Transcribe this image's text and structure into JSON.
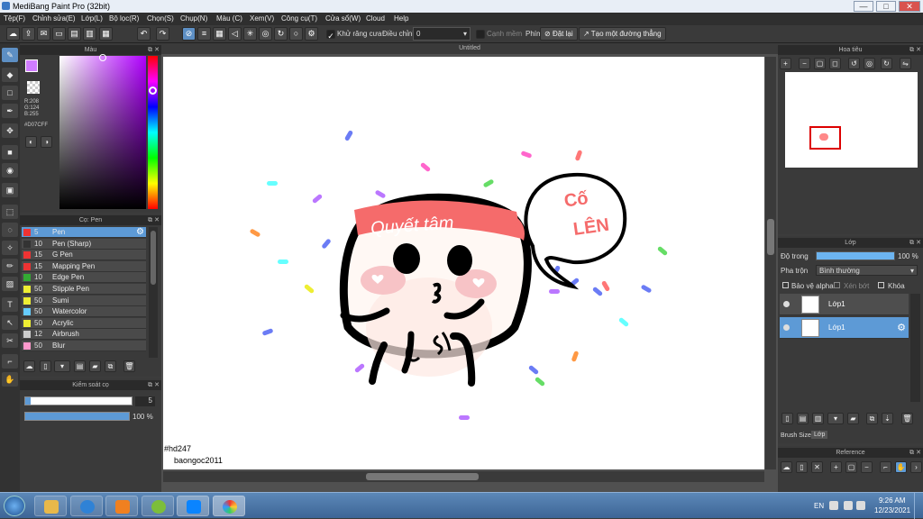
{
  "window": {
    "title": "MediBang Paint Pro (32bit)",
    "minimize": "—",
    "maximize": "□",
    "close": "✕"
  },
  "menu": [
    "Tệp(F)",
    "Chỉnh sửa(E)",
    "Lớp(L)",
    "Bộ lọc(R)",
    "Chọn(S)",
    "Chụp(N)",
    "Màu (C)",
    "Xem(V)",
    "Công cụ(T)",
    "Cửa sổ(W)",
    "Cloud",
    "Help"
  ],
  "toolbar": {
    "antialias_label": "Khử răng cưa",
    "adjust_label": "Điều chỉnh",
    "adjust_value": "0",
    "edge_label": "Cạnh mềm",
    "key_label": "Phím",
    "reset_label": "Đặt lại",
    "straight_line_label": "Tạo một đường thẳng"
  },
  "color_panel": {
    "title": "Màu",
    "r": "R:208",
    "g": "G:124",
    "b": "B:255",
    "hex": "#D07CFF",
    "fg_color": "#D07CFF"
  },
  "brush_panel": {
    "title": "Cọ: Pen",
    "items": [
      {
        "size": "5",
        "name": "Pen",
        "color": "#e33"
      },
      {
        "size": "10",
        "name": "Pen (Sharp)",
        "color": "#333"
      },
      {
        "size": "15",
        "name": "G Pen",
        "color": "#e33"
      },
      {
        "size": "15",
        "name": "Mapping Pen",
        "color": "#e33"
      },
      {
        "size": "10",
        "name": "Edge Pen",
        "color": "#3a3"
      },
      {
        "size": "50",
        "name": "Stipple Pen",
        "color": "#ee3"
      },
      {
        "size": "50",
        "name": "Sumi",
        "color": "#ee3"
      },
      {
        "size": "50",
        "name": "Watercolor",
        "color": "#6cf"
      },
      {
        "size": "50",
        "name": "Acrylic",
        "color": "#ee3"
      },
      {
        "size": "12",
        "name": "Airbrush",
        "color": "#ccc"
      },
      {
        "size": "50",
        "name": "Blur",
        "color": "#f9c"
      }
    ]
  },
  "brush_control": {
    "title": "Kiểm soát cọ",
    "size_value": "5",
    "opacity_value": "100 %",
    "size_fraction": 0.05,
    "opacity_fraction": 1.0
  },
  "canvas": {
    "title": "Untitled",
    "headband_text": "Quyết tâm",
    "bubble_text_1": "Cố",
    "bubble_text_2": "LÊN",
    "watermark_1": "#hd247",
    "watermark_2": "baongoc2011"
  },
  "navigator": {
    "title": "Hoa tiêu"
  },
  "layer_panel": {
    "title": "Lớp",
    "opacity_label": "Độ trong",
    "opacity_value": "100 %",
    "opacity_fraction": 1.0,
    "blend_label": "Pha trộn",
    "blend_value": "Bình thường",
    "protect_alpha": "Bảo vệ alpha",
    "clipping": "Xén bớt",
    "lock": "Khóa",
    "layers": [
      "Lớp1",
      "Lớp1"
    ],
    "tab_brush_size": "Brush Size",
    "tab_layer": "Lớp"
  },
  "reference": {
    "title": "Reference"
  },
  "tray": {
    "lang": "EN",
    "time": "9:26 AM",
    "date": "12/23/2021"
  }
}
